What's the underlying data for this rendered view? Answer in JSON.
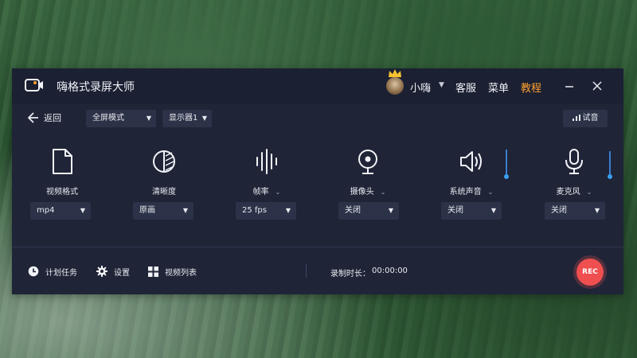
{
  "app": {
    "title": "嗨格式录屏大师"
  },
  "user": {
    "name": "小嗨",
    "caret": "▼"
  },
  "menu": {
    "service": "客服",
    "menu": "菜单",
    "tutorial": "教程"
  },
  "toolbar": {
    "back_label": "返回",
    "mode_value": "全屏模式",
    "display_value": "显示器1",
    "test_label": "试音",
    "caret": "▼"
  },
  "columns": [
    {
      "label": "视频格式",
      "value": "mp4",
      "has_caret": false,
      "icon": "file-icon"
    },
    {
      "label": "清晰度",
      "value": "原画",
      "has_caret": false,
      "icon": "clarity-icon"
    },
    {
      "label": "帧率",
      "value": "25 fps",
      "has_caret": true,
      "icon": "waveform-icon"
    },
    {
      "label": "摄像头",
      "value": "关闭",
      "has_caret": true,
      "icon": "webcam-icon"
    },
    {
      "label": "系统声音",
      "value": "关闭",
      "has_caret": true,
      "icon": "speaker-icon"
    },
    {
      "label": "麦克风",
      "value": "关闭",
      "has_caret": true,
      "icon": "microphone-icon"
    }
  ],
  "label_caret": "⌄",
  "bottom": {
    "schedule_label": "计划任务",
    "settings_label": "设置",
    "video_list_label": "视频列表",
    "record_time_label": "录制时长：",
    "record_time_value": "00:00:00",
    "rec_label": "REC"
  },
  "colors": {
    "window_bg": "#1f2437",
    "titlebar_bg": "#1b2033",
    "dropdown_bg": "#2c3247",
    "accent": "#ffa02e",
    "rec": "#ef4f4f",
    "volume": "#3a9ff0"
  }
}
